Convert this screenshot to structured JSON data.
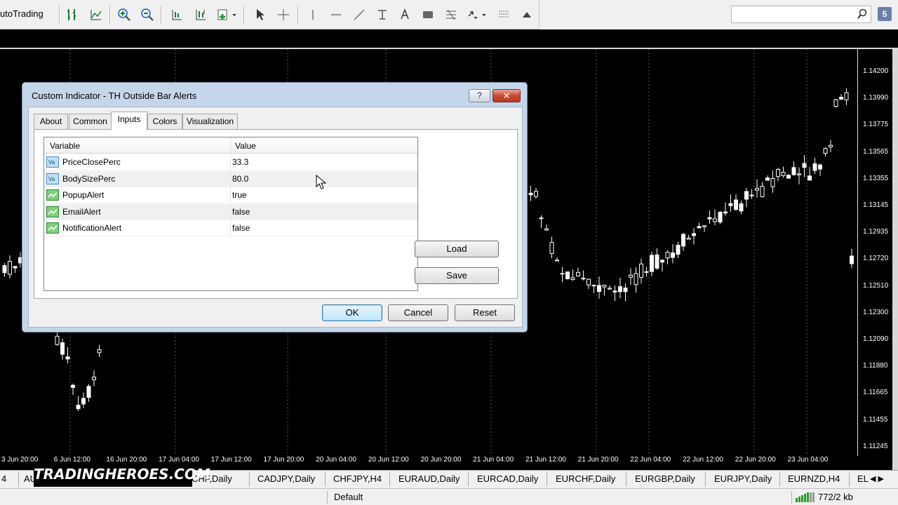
{
  "toolbar": {
    "autotrading_label": "utoTrading",
    "help_label": "5"
  },
  "chart": {
    "price_labels": [
      "1.14200",
      "1.13990",
      "1.13775",
      "1.13565",
      "1.13355",
      "1.13145",
      "1.12935",
      "1.12720",
      "1.12510",
      "1.12300",
      "1.12090",
      "1.11880",
      "1.11665",
      "1.11455",
      "1.11245"
    ],
    "time_labels": [
      "3 Jun 20:00",
      "6 Jun 12:00",
      "16 Jun 20:00",
      "17 Jun 04:00",
      "17 Jun 12:00",
      "17 Jun 20:00",
      "20 Jun 04:00",
      "20 Jun 12:00",
      "20 Jun 20:00",
      "21 Jun 04:00",
      "21 Jun 12:00",
      "21 Jun 20:00",
      "22 Jun 04:00",
      "22 Jun 12:00",
      "22 Jun 20:00",
      "23 Jun 04:00"
    ]
  },
  "symbol_tabs": [
    "4",
    "AU",
    "CHF,Daily",
    "CADJPY,Daily",
    "CHFJPY,H4",
    "EURAUD,Daily",
    "EURCAD,Daily",
    "EURCHF,Daily",
    "EURGBP,Daily",
    "EURJPY,Daily",
    "EURNZD,H4",
    "EL"
  ],
  "watermark": "TRADINGHEROES.COM",
  "status": {
    "profile": "Default",
    "traffic": "772/2 kb"
  },
  "dialog": {
    "title": "Custom Indicator - TH Outside Bar Alerts",
    "help": "?",
    "close": "✕",
    "tabs": [
      "About",
      "Common",
      "Inputs",
      "Colors",
      "Visualization"
    ],
    "active_tab": "Inputs",
    "grid": {
      "headers": [
        "Variable",
        "Value"
      ],
      "rows": [
        {
          "name": "PriceClosePerc",
          "value": "33.3",
          "type": "double"
        },
        {
          "name": "BodySizePerc",
          "value": "80.0",
          "type": "double"
        },
        {
          "name": "PopupAlert",
          "value": "true",
          "type": "bool"
        },
        {
          "name": "EmailAlert",
          "value": "false",
          "type": "bool"
        },
        {
          "name": "NotificationAlert",
          "value": "false",
          "type": "bool"
        }
      ]
    },
    "buttons": {
      "load": "Load",
      "save": "Save",
      "ok": "OK",
      "cancel": "Cancel",
      "reset": "Reset"
    }
  }
}
